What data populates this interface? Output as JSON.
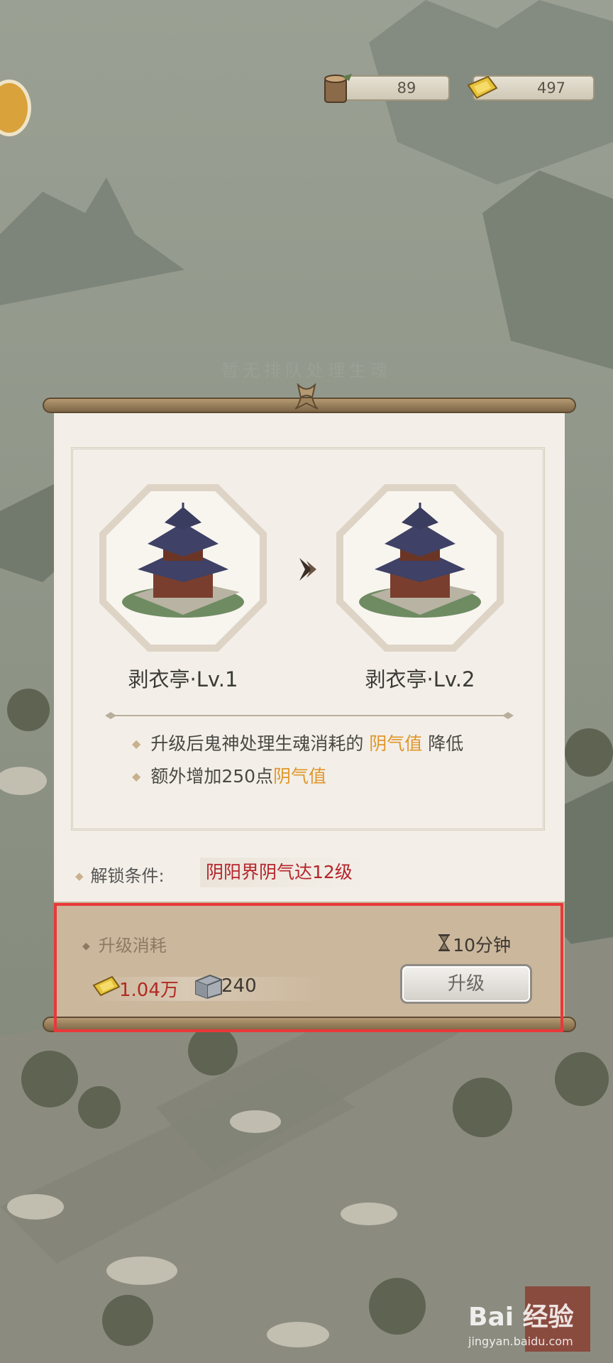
{
  "resources": [
    {
      "icon": "wood-log-icon",
      "value": "89"
    },
    {
      "icon": "gold-paper-icon",
      "value": "497"
    }
  ],
  "queue_status": "暂无排队处理生魂",
  "building": {
    "current_name": "剥衣亭·Lv.1",
    "next_name": "剥衣亭·Lv.2"
  },
  "effects": {
    "line1_pre": "升级后鬼神处理生魂消耗的",
    "line1_highlight": "阴气值",
    "line1_post": "降低",
    "line2_pre": "额外增加250点",
    "line2_highlight": "阴气值"
  },
  "unlock": {
    "label": "解锁条件:",
    "value": "阴阳界阴气达12级"
  },
  "cost": {
    "title": "升级消耗",
    "time": "10分钟",
    "gold": "1.04万",
    "stone": "240",
    "upgrade_button": "升级"
  },
  "watermark": {
    "brand": "Bai 经验",
    "url": "jingyan.baidu.com"
  },
  "colors": {
    "highlight": "#e0962a",
    "warning_text": "#b5242b",
    "selection_box": "#e9383a"
  }
}
